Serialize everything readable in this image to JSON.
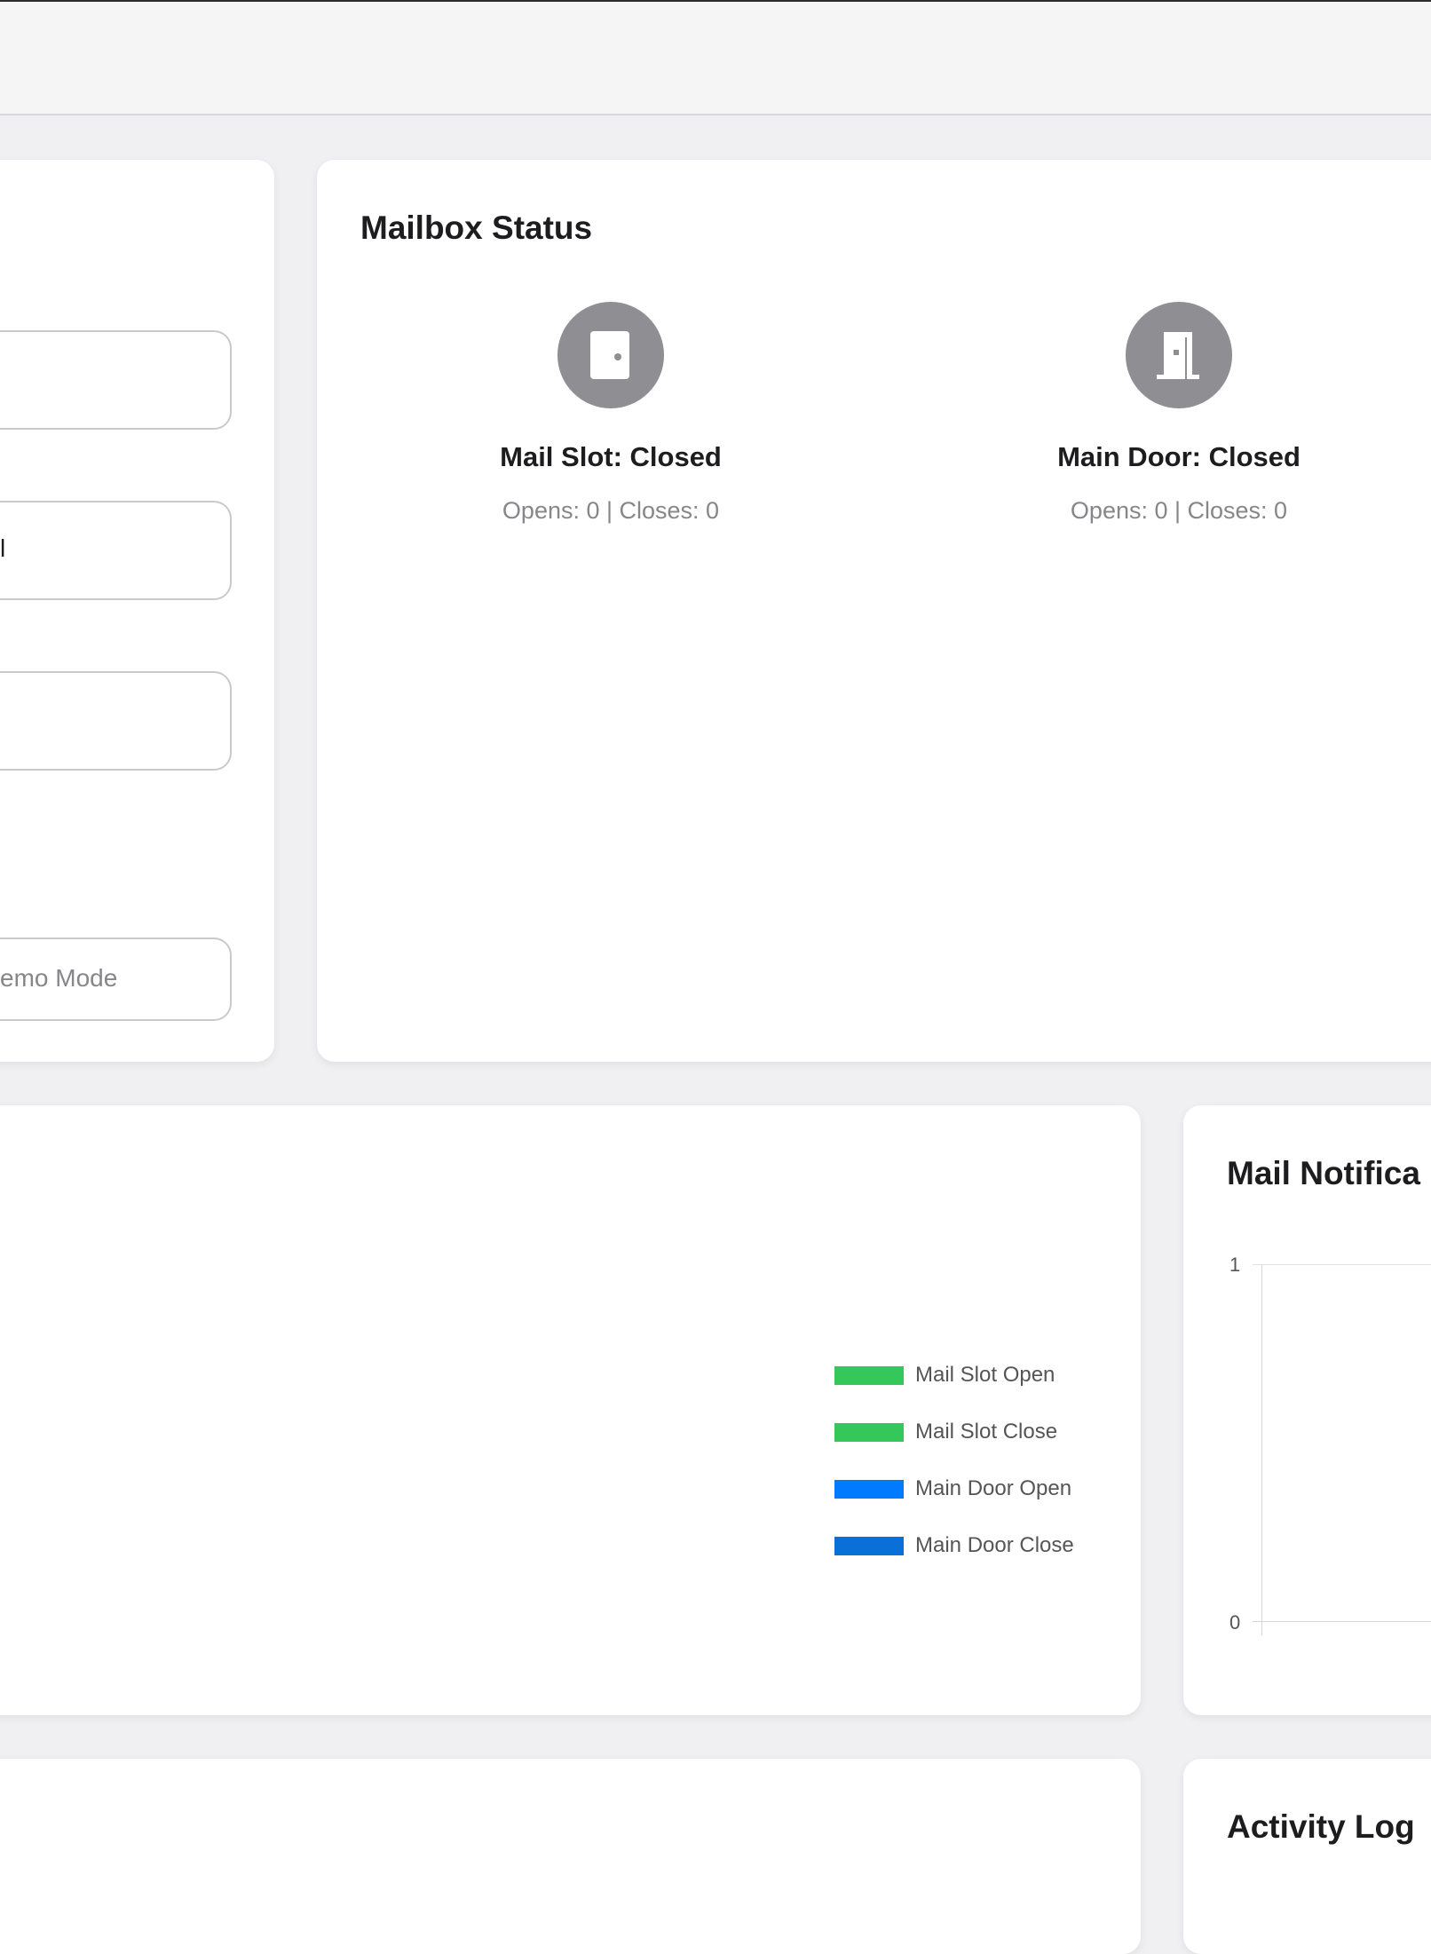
{
  "settings": {
    "demo_button_label": "emo Mode",
    "field2_value": "l"
  },
  "mailbox_status": {
    "title": "Mailbox Status",
    "items": [
      {
        "label": "Mail Slot: Closed",
        "counts": "Opens: 0 | Closes: 0",
        "icon": "door-icon"
      },
      {
        "label": "Main Door: Closed",
        "counts": "Opens: 0 | Closes: 0",
        "icon": "door-open-icon"
      }
    ]
  },
  "events_chart": {
    "legend": [
      {
        "label": "Mail Slot Open",
        "color": "#34c759"
      },
      {
        "label": "Mail Slot Close",
        "color": "#34c759"
      },
      {
        "label": "Main Door Open",
        "color": "#007aff"
      },
      {
        "label": "Main Door Close",
        "color": "#0a6fd6"
      }
    ]
  },
  "notifications": {
    "title": "Mail Notifica",
    "y_tick_top": "1",
    "y_tick_bottom": "0"
  },
  "activity_log": {
    "title": "Activity Log"
  },
  "chart_data": {
    "type": "line",
    "title": "Mail Notifica",
    "ylim": [
      0,
      1
    ],
    "y_ticks": [
      "0",
      "1"
    ],
    "series": []
  }
}
